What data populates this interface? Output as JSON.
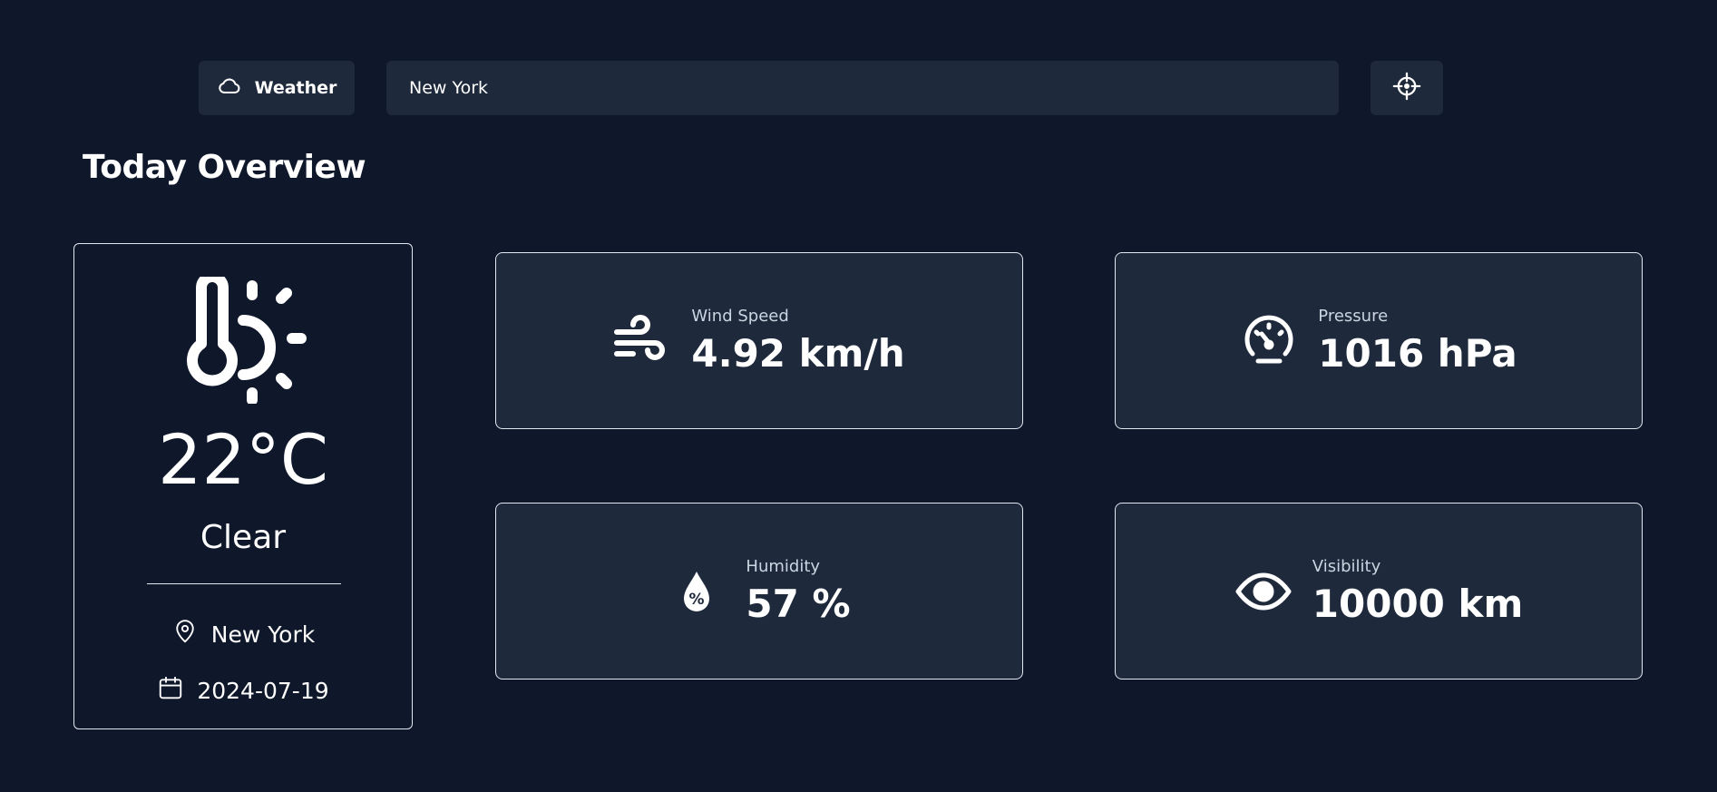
{
  "header": {
    "brand_label": "Weather",
    "brand_icon": "cloud-icon",
    "search_value": "New York",
    "locate_icon": "crosshair-icon"
  },
  "section_title": "Today Overview",
  "today": {
    "icon": "thermometer-sun-icon",
    "temperature": "22°C",
    "condition": "Clear",
    "location": "New York",
    "location_icon": "map-pin-icon",
    "date": "2024-07-19",
    "date_icon": "calendar-icon"
  },
  "stats": {
    "wind": {
      "label": "Wind Speed",
      "value": "4.92 km/h",
      "icon": "wind-icon"
    },
    "pressure": {
      "label": "Pressure",
      "value": "1016 hPa",
      "icon": "gauge-icon"
    },
    "humidity": {
      "label": "Humidity",
      "value": "57 %",
      "icon": "droplet-percent-icon"
    },
    "visibility": {
      "label": "Visibility",
      "value": "10000 km",
      "icon": "eye-icon"
    }
  },
  "colors": {
    "background": "#0f172a",
    "card": "#1e293b",
    "border": "#e2e8f0",
    "text": "#ffffff",
    "muted_text": "#cbd5e1"
  }
}
